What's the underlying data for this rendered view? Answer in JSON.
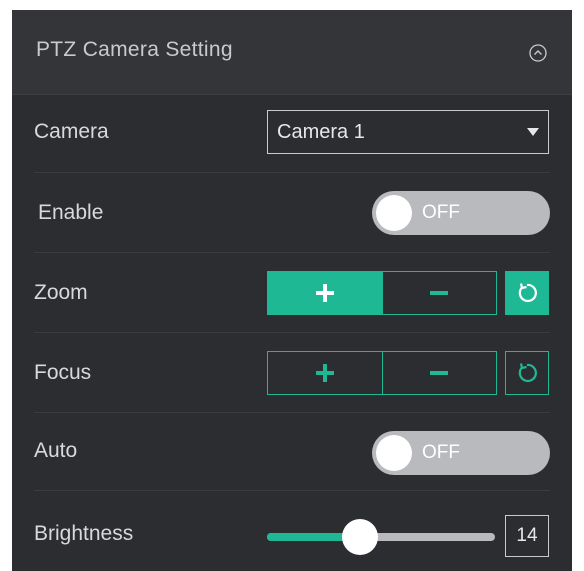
{
  "panel": {
    "title": "PTZ Camera Setting",
    "collapse_icon": "chevron-up-circle-icon"
  },
  "camera": {
    "label": "Camera",
    "selected": "Camera 1",
    "caret_icon": "caret-down-icon"
  },
  "enable": {
    "label": "Enable",
    "state": "OFF",
    "on": false
  },
  "zoom": {
    "label": "Zoom",
    "plus_icon": "plus-icon",
    "minus_icon": "minus-icon",
    "reset_icon": "reset-icon",
    "active": "plus"
  },
  "focus": {
    "label": "Focus",
    "plus_icon": "plus-icon",
    "minus_icon": "minus-icon",
    "reset_icon": "reset-icon"
  },
  "auto": {
    "label": "Auto",
    "state": "OFF",
    "on": false
  },
  "brightness": {
    "label": "Brightness",
    "value": "14",
    "fraction": 0.41
  },
  "colors": {
    "accent": "#1fb894",
    "panel_bg": "#2b2d31",
    "header_bg": "#333539",
    "toggle_off": "#b9babd"
  }
}
